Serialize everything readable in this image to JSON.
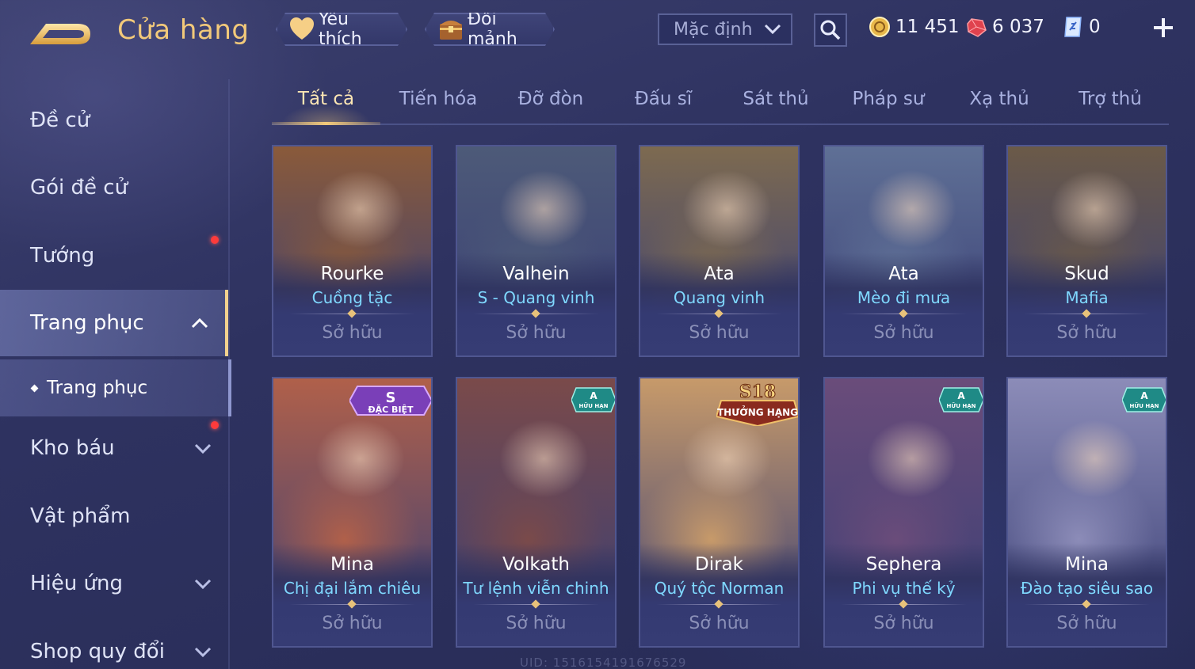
{
  "header": {
    "title": "Cửa hàng",
    "favorite_label": "Yêu thích",
    "shard_label": "Đổi mảnh",
    "sort_value": "Mặc định",
    "currencies": [
      {
        "name": "gold-coin-icon",
        "value": "11 451"
      },
      {
        "name": "ruby-icon",
        "value": "6 037"
      },
      {
        "name": "voucher-icon",
        "value": "0"
      }
    ]
  },
  "sidebar": {
    "items": [
      {
        "label": "Đề cử"
      },
      {
        "label": "Gói đề cử"
      },
      {
        "label": "Tướng"
      },
      {
        "label": "Trang phục"
      },
      {
        "label": "Kho báu"
      },
      {
        "label": "Vật phẩm"
      },
      {
        "label": "Hiệu ứng"
      },
      {
        "label": "Shop quy đổi"
      }
    ],
    "sub_item": "Trang phục"
  },
  "tabs": [
    "Tất cả",
    "Tiến hóa",
    "Đỡ đòn",
    "Đấu sĩ",
    "Sát thủ",
    "Pháp sư",
    "Xạ thủ",
    "Trợ thủ"
  ],
  "cards": [
    {
      "hero": "Rourke",
      "skin": "Cuồng tặc",
      "status": "Sở hữu",
      "tone": "#8a5a3a"
    },
    {
      "hero": "Valhein",
      "skin": "S - Quang vinh",
      "status": "Sở hữu",
      "tone": "#4d5a78"
    },
    {
      "hero": "Ata",
      "skin": "Quang vinh",
      "status": "Sở hữu",
      "tone": "#7d6a50"
    },
    {
      "hero": "Ata",
      "skin": "Mèo đi mưa",
      "status": "Sở hữu",
      "tone": "#5f7096"
    },
    {
      "hero": "Skud",
      "skin": "Mafia",
      "status": "Sở hữu",
      "tone": "#6b5a48"
    },
    {
      "hero": "Mina",
      "skin": "Chị đại lắm chiêu",
      "status": "Sở hữu",
      "tone": "#b0604a",
      "badge": {
        "type": "special",
        "top": "S",
        "bottom": "ĐẶC BIỆT"
      }
    },
    {
      "hero": "Volkath",
      "skin": "Tư lệnh viễn chinh",
      "status": "Sở hữu",
      "tone": "#7a4a4a",
      "badge": {
        "type": "limited",
        "top": "A",
        "bottom": "HỮU HẠN"
      }
    },
    {
      "hero": "Dirak",
      "skin": "Quý tộc Norman",
      "status": "Sở hữu",
      "tone": "#c79a6a",
      "badge": {
        "type": "season",
        "top": "S18",
        "bottom": "THƯỞNG HẠNG"
      }
    },
    {
      "hero": "Sephera",
      "skin": "Phi vụ thế kỷ",
      "status": "Sở hữu",
      "tone": "#6a4c7a",
      "badge": {
        "type": "limited",
        "top": "A",
        "bottom": "HỮU HẠN"
      }
    },
    {
      "hero": "Mina",
      "skin": "Đào tạo siêu sao",
      "status": "Sở hữu",
      "tone": "#8c8cb8",
      "badge": {
        "type": "limited",
        "top": "A",
        "bottom": "HỮU HẠN"
      }
    }
  ],
  "footer": {
    "uid": "UID: 1516154191676529"
  }
}
